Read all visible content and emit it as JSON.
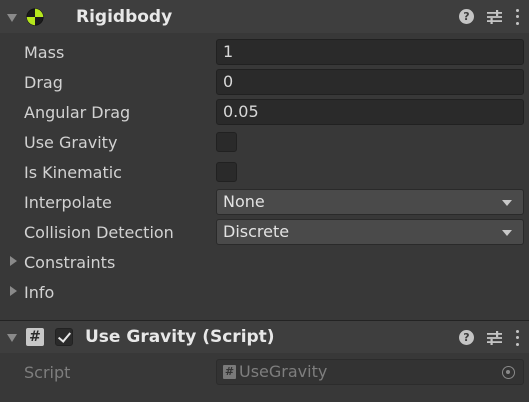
{
  "rigidbody": {
    "title": "Rigidbody",
    "fields": [
      {
        "label": "Mass",
        "value": "1"
      },
      {
        "label": "Drag",
        "value": "0"
      },
      {
        "label": "Angular Drag",
        "value": "0.05"
      }
    ],
    "use_gravity_label": "Use Gravity",
    "use_gravity_checked": false,
    "is_kinematic_label": "Is Kinematic",
    "is_kinematic_checked": false,
    "interpolate_label": "Interpolate",
    "interpolate_value": "None",
    "collision_label": "Collision Detection",
    "collision_value": "Discrete",
    "constraints_label": "Constraints",
    "info_label": "Info"
  },
  "script_component": {
    "title": "Use Gravity (Script)",
    "enabled": true,
    "script_label": "Script",
    "script_value": "UseGravity"
  },
  "icons": {
    "help": "?",
    "hash": "#"
  },
  "colors": {
    "background": "#383838",
    "header": "#3e3e3e",
    "field": "#2a2a2a",
    "text": "#d2d2d2",
    "rigidbody_icon_green": "#b5e61d"
  }
}
